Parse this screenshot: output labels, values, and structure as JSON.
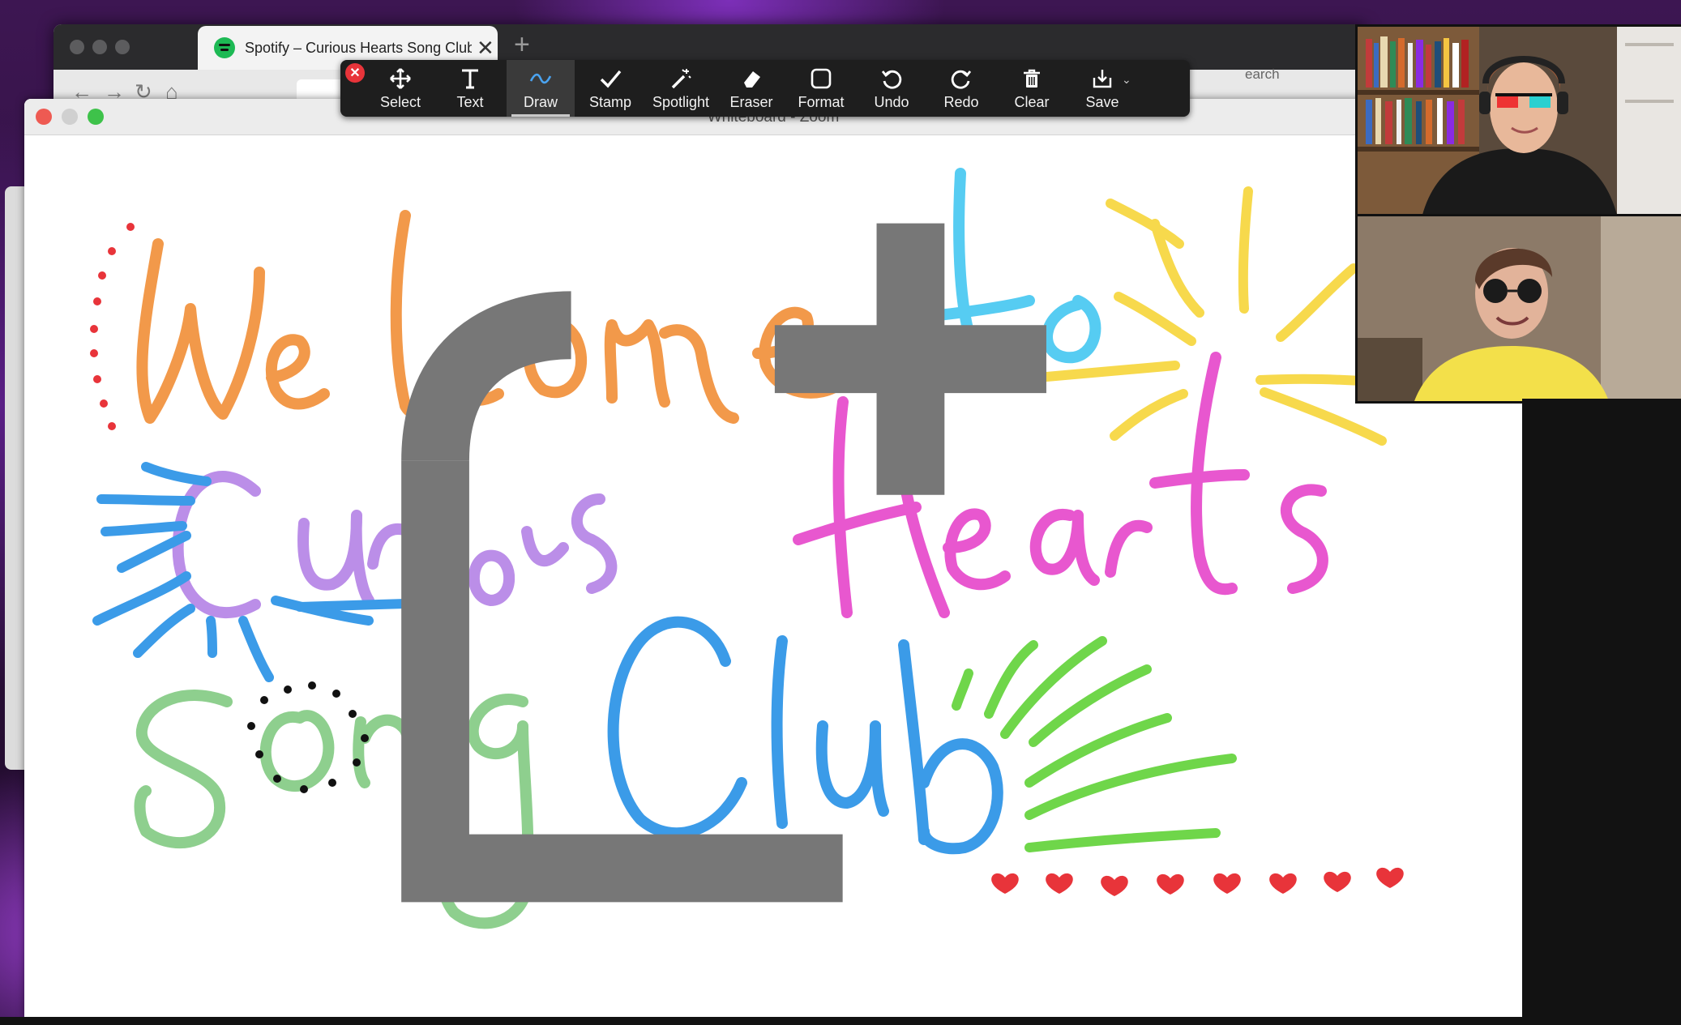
{
  "browser": {
    "tab_title": "Spotify – Curious Hearts Song Club",
    "new_tab_symbol": "+",
    "close_symbol": "✕",
    "search_hint": "earch"
  },
  "whiteboard": {
    "title": "Whiteboard - Zoom",
    "drawing": {
      "line1": [
        "Welcome",
        "to"
      ],
      "line2": [
        "Curious",
        "Hearts"
      ],
      "line3": [
        "Song",
        "Club"
      ],
      "colors": {
        "welcome": "#f2994a",
        "to": "#56ccf2",
        "curious": "#bb8ee8",
        "hearts": "#e857cf",
        "song": "#8ecf8e",
        "club": "#3b9be8",
        "sun": "#f7d94c",
        "rays_blue": "#3b9be8",
        "grass": "#6fd64a",
        "hearts_row": "#e8343a",
        "dots_red": "#e8343a",
        "dots_black": "#111111"
      },
      "heart_count": 8
    }
  },
  "toolbar": {
    "close_symbol": "✕",
    "tools": [
      {
        "id": "select",
        "label": "Select",
        "icon": "move-arrows-icon"
      },
      {
        "id": "text",
        "label": "Text",
        "icon": "text-t-icon"
      },
      {
        "id": "draw",
        "label": "Draw",
        "icon": "squiggle-icon",
        "active": true
      },
      {
        "id": "stamp",
        "label": "Stamp",
        "icon": "checkmark-icon"
      },
      {
        "id": "spotlight",
        "label": "Spotlight",
        "icon": "magic-wand-icon"
      },
      {
        "id": "eraser",
        "label": "Eraser",
        "icon": "eraser-icon"
      },
      {
        "id": "format",
        "label": "Format",
        "icon": "rounded-square-icon"
      },
      {
        "id": "undo",
        "label": "Undo",
        "icon": "undo-arrow-icon"
      },
      {
        "id": "redo",
        "label": "Redo",
        "icon": "redo-arrow-icon"
      },
      {
        "id": "clear",
        "label": "Clear",
        "icon": "trash-icon"
      },
      {
        "id": "save",
        "label": "Save",
        "icon": "save-download-icon"
      }
    ]
  },
  "participants": [
    {
      "id": "participant-1",
      "shirt": "#1a1a1a",
      "glasses": "3d"
    },
    {
      "id": "participant-2",
      "shirt": "#f3e04a",
      "glasses": "round-dark"
    }
  ]
}
